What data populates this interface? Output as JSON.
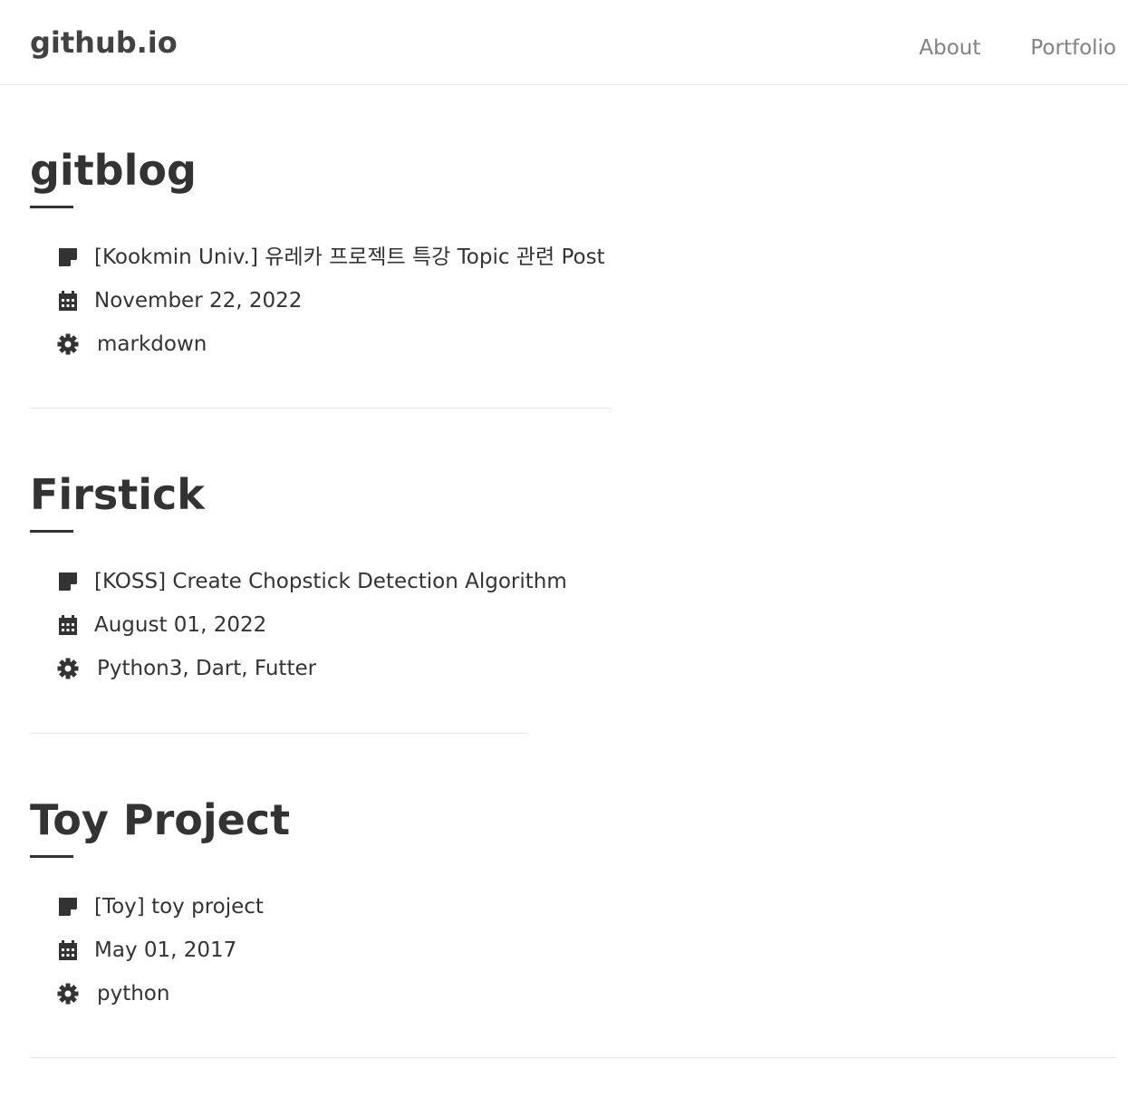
{
  "header": {
    "brand": "github.io",
    "nav": [
      {
        "label": "About"
      },
      {
        "label": "Portfolio"
      }
    ]
  },
  "projects": [
    {
      "title": "gitblog",
      "post": "[Kookmin Univ.] 유레카 프로젝트 특강 Topic 관련 Post",
      "date": "November 22, 2022",
      "tags": "markdown"
    },
    {
      "title": "Firstick",
      "post": "[KOSS] Create Chopstick Detection Algorithm",
      "date": "August 01, 2022",
      "tags": "Python3, Dart, Futter"
    },
    {
      "title": "Toy Project",
      "post": "[Toy] toy project",
      "date": "May 01, 2017",
      "tags": "python"
    }
  ],
  "icons": {
    "post": "note-icon",
    "date": "calendar-icon",
    "tags": "gear-icon"
  },
  "colors": {
    "text": "#333333",
    "nav": "#828282",
    "brand": "#424242",
    "divider": "#e6e6e6"
  }
}
